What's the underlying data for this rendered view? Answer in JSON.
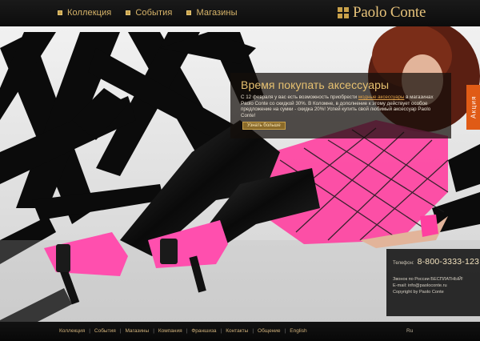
{
  "topnav": {
    "items": [
      {
        "label": "Коллекция"
      },
      {
        "label": "События"
      },
      {
        "label": "Магазины"
      }
    ]
  },
  "logo": {
    "text": "Paolo Conte"
  },
  "promo": {
    "title": "Время покупать аксессуары",
    "text_before_link": "С 12 февраля у вас есть возможность приобрести ",
    "link": "модные аксессуары",
    "text_after_link": " в магазинах Paolo Conte со скидкой 30%. В Коломне, в дополнение к этому действует особое предложение на сумки - скидка 20%! Успей купить свой любимый аксессуар Paolo Conte!",
    "button": "Узнать больше"
  },
  "side_tab": {
    "label": "Акция"
  },
  "contact": {
    "phone_label": "Телефон:",
    "phone": "8-800-3333-123",
    "free_call": "Звонок по России БЕСПЛАТНЫЙ!",
    "email": "E-mail: info@paoloconte.ru",
    "copyright": "Copyright by Paolo Conte"
  },
  "bottomnav": {
    "items": [
      {
        "label": "Коллекция"
      },
      {
        "label": "События"
      },
      {
        "label": "Магазины"
      },
      {
        "label": "Компания"
      },
      {
        "label": "Франшиза"
      },
      {
        "label": "Контакты"
      },
      {
        "label": "Общение"
      },
      {
        "label": "English"
      }
    ]
  },
  "lang": {
    "label": "Ru"
  },
  "colors": {
    "gold": "#c9a14a",
    "accent_orange": "#e05b16",
    "pink": "#ff3fa0"
  }
}
